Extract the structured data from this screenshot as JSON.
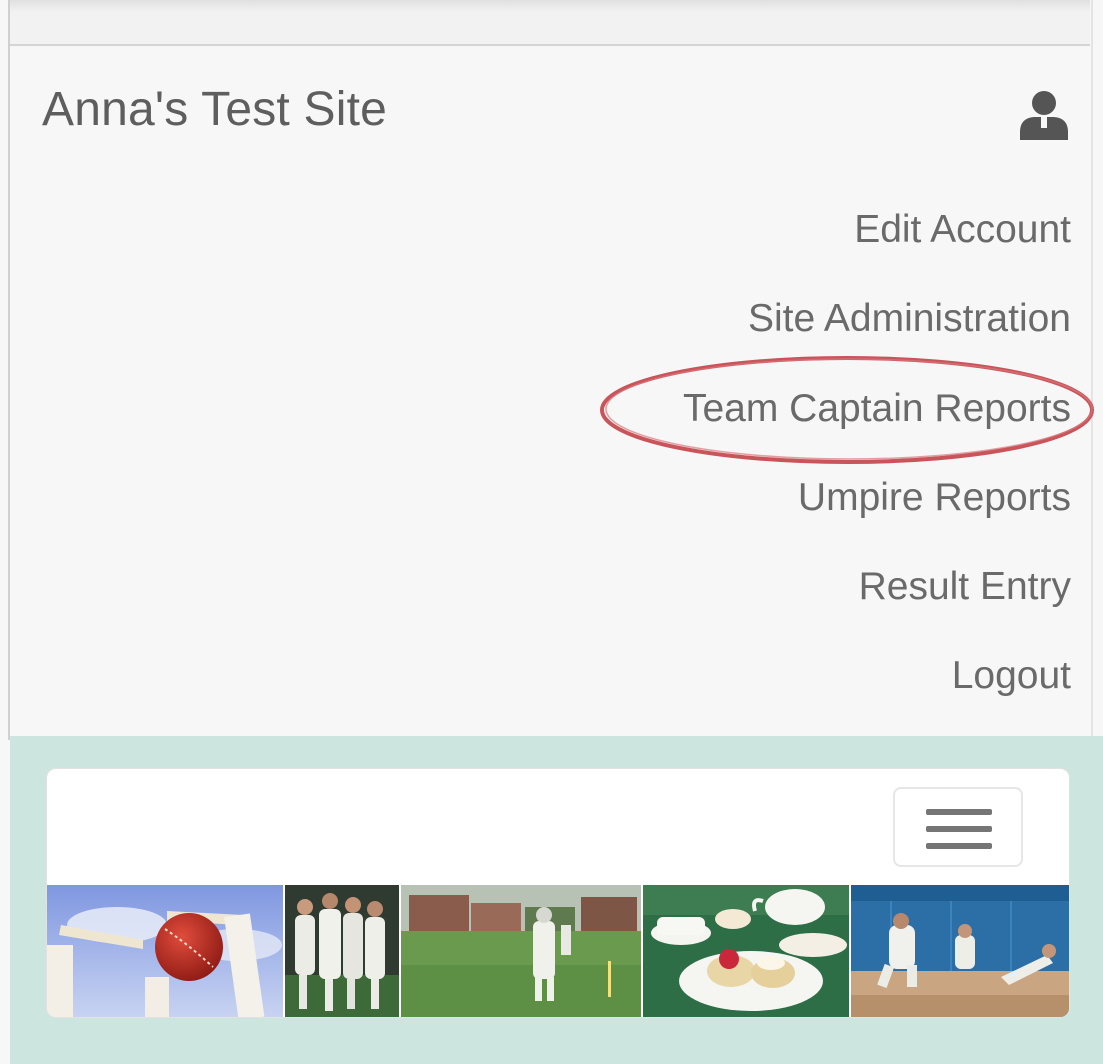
{
  "header": {
    "site_title": "Anna's Test Site",
    "user_icon": "user-icon"
  },
  "account_menu": {
    "items": [
      {
        "label": "Edit Account",
        "highlighted": false
      },
      {
        "label": "Site Administration",
        "highlighted": false
      },
      {
        "label": "Team Captain Reports",
        "highlighted": true
      },
      {
        "label": "Umpire Reports",
        "highlighted": false
      },
      {
        "label": "Result Entry",
        "highlighted": false
      },
      {
        "label": "Logout",
        "highlighted": false
      }
    ]
  },
  "nav": {
    "toggle_icon": "hamburger-menu-icon"
  },
  "banner": {
    "photos": [
      "cricket-ball-stumps-photo",
      "team-celebration-photo",
      "batsman-on-field-photo",
      "cream-tea-photo",
      "indoor-cricket-photo"
    ]
  },
  "colors": {
    "background": "#f7f7f7",
    "band": "#cce6df",
    "text": "#6a6a6a",
    "highlight": "#c9545a"
  }
}
